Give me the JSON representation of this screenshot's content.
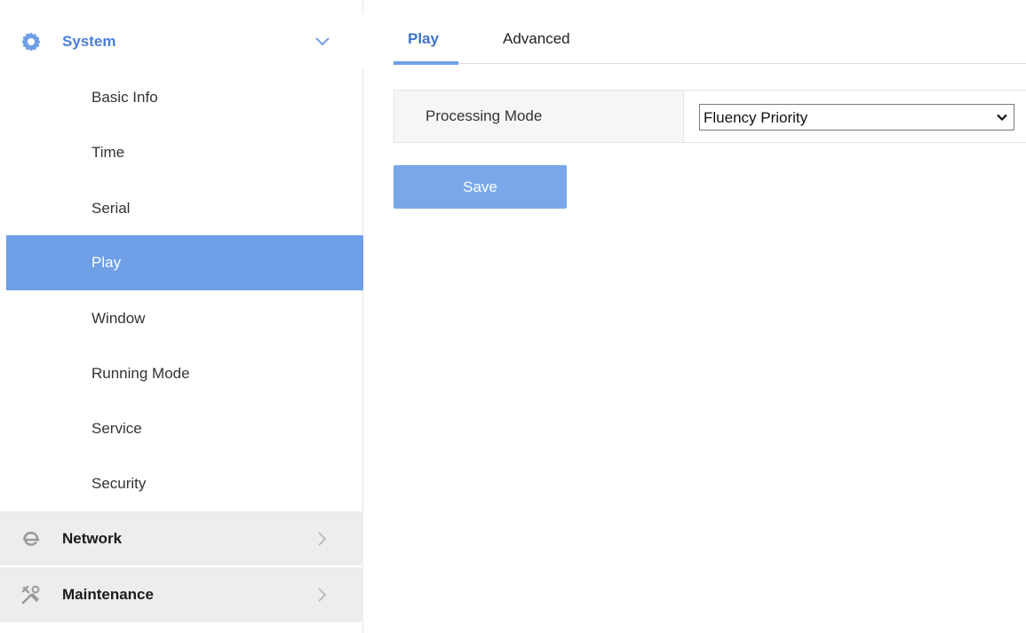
{
  "sidebar": {
    "system": {
      "label": "System",
      "icon": "gear-icon",
      "expanded": true
    },
    "items": [
      {
        "label": "Basic Info"
      },
      {
        "label": "Time"
      },
      {
        "label": "Serial"
      },
      {
        "label": "Play"
      },
      {
        "label": "Window"
      },
      {
        "label": "Running Mode"
      },
      {
        "label": "Service"
      },
      {
        "label": "Security"
      }
    ],
    "active_item": "Play",
    "network": {
      "label": "Network",
      "icon": "network-e-icon"
    },
    "maintenance": {
      "label": "Maintenance",
      "icon": "tools-icon"
    }
  },
  "tabs": [
    {
      "label": "Play",
      "active": true
    },
    {
      "label": "Advanced",
      "active": false
    }
  ],
  "form": {
    "processing_mode": {
      "label": "Processing Mode",
      "value": "Fluency Priority"
    }
  },
  "actions": {
    "save_label": "Save"
  },
  "colors": {
    "accent": "#6f9fe6",
    "tab_active_text": "#3f73c9",
    "system_label": "#4a7fd8",
    "save_button": "#7aa7e9",
    "group_bg": "#ededed"
  }
}
